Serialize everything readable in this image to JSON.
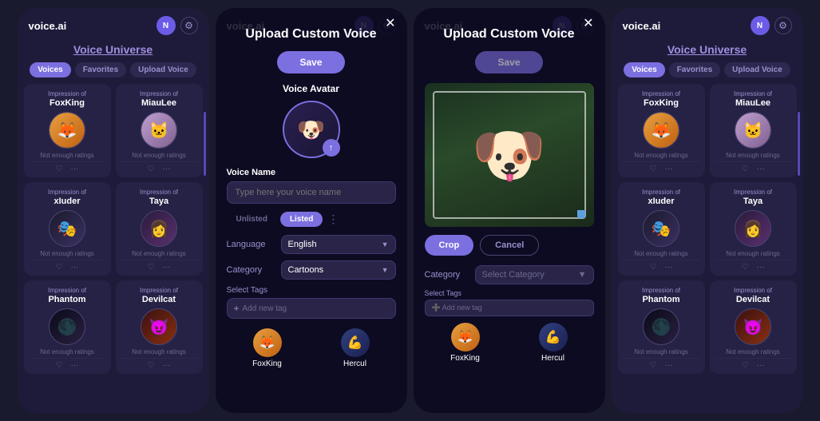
{
  "app": {
    "logo": "voice.ai",
    "avatar_letter": "N"
  },
  "screens": [
    {
      "id": "screen1",
      "type": "main",
      "title": "Voice Universe",
      "tabs": [
        "Voices",
        "Favorites",
        "Upload Voice"
      ],
      "active_tab": "Voices",
      "voices": [
        {
          "label": "Impression of",
          "name": "FoxKing",
          "avatar_type": "fox",
          "emoji": "🦊",
          "rating": "Not enough ratings"
        },
        {
          "label": "Impression of",
          "name": "MiauLee",
          "avatar_type": "miau",
          "emoji": "🐱",
          "rating": "Not enough ratings"
        },
        {
          "label": "Impression of",
          "name": "xIuder",
          "avatar_type": "xiuder",
          "emoji": "🎭",
          "rating": "Not enough ratings"
        },
        {
          "label": "Impression of",
          "name": "Taya",
          "avatar_type": "taya",
          "emoji": "👩",
          "rating": "Not enough ratings"
        },
        {
          "label": "Impression of",
          "name": "Phantom",
          "avatar_type": "phantom",
          "emoji": "🌑",
          "rating": "Not enough ratings"
        },
        {
          "label": "Impression of",
          "name": "Devilcat",
          "avatar_type": "devilcat",
          "emoji": "😈",
          "rating": "Not enough ratings"
        }
      ]
    },
    {
      "id": "screen2",
      "type": "upload-modal",
      "title": "Upload Custom Voice",
      "save_label": "Save",
      "voice_avatar_label": "Voice Avatar",
      "voice_name_label": "Voice Name",
      "voice_name_placeholder": "Type here your voice name",
      "toggle_options": [
        "Unlisted",
        "Listed"
      ],
      "active_toggle": "Listed",
      "language_label": "Language",
      "language_value": "English",
      "category_label": "Category",
      "category_value": "Cartoons",
      "select_tags_label": "Select Tags",
      "add_tag_placeholder": "➕ Add new tag",
      "bottom_voices": [
        "FoxKing",
        "Hercul"
      ]
    },
    {
      "id": "screen3",
      "type": "crop-modal",
      "title": "Upload Custom Voice",
      "save_label": "Save",
      "crop_label": "Crop",
      "cancel_label": "Cancel",
      "category_label": "Category",
      "category_placeholder": "Select Category",
      "select_tags_label": "Select Tags",
      "add_tag_placeholder": "➕ Add new tag",
      "bottom_voices": [
        "FoxKing",
        "Hercul"
      ]
    },
    {
      "id": "screen4",
      "type": "main",
      "title": "Voice Universe",
      "tabs": [
        "Voices",
        "Favorites",
        "Upload Voice"
      ],
      "active_tab": "Voices",
      "voices": [
        {
          "label": "Impression of",
          "name": "FoxKing",
          "avatar_type": "fox",
          "emoji": "🦊",
          "rating": "Not enough ratings"
        },
        {
          "label": "Impression of",
          "name": "MiauLee",
          "avatar_type": "miau",
          "emoji": "🐱",
          "rating": "Not enough ratings"
        },
        {
          "label": "Impression of",
          "name": "xIuder",
          "avatar_type": "xiuder",
          "emoji": "🎭",
          "rating": "Not enough ratings"
        },
        {
          "label": "Impression of",
          "name": "Taya",
          "avatar_type": "taya",
          "emoji": "👩",
          "rating": "Not enough ratings"
        },
        {
          "label": "Impression of",
          "name": "Phantom",
          "avatar_type": "phantom",
          "emoji": "🌑",
          "rating": "Not enough ratings"
        },
        {
          "label": "Impression of",
          "name": "Devilcat",
          "avatar_type": "devilcat",
          "emoji": "😈",
          "rating": "Not enough ratings"
        }
      ]
    }
  ],
  "colors": {
    "accent": "#7c6fe0",
    "bg_dark": "#1e1b3a",
    "card_bg": "#252245",
    "text_muted": "#9990cc",
    "border": "#3d3870"
  }
}
